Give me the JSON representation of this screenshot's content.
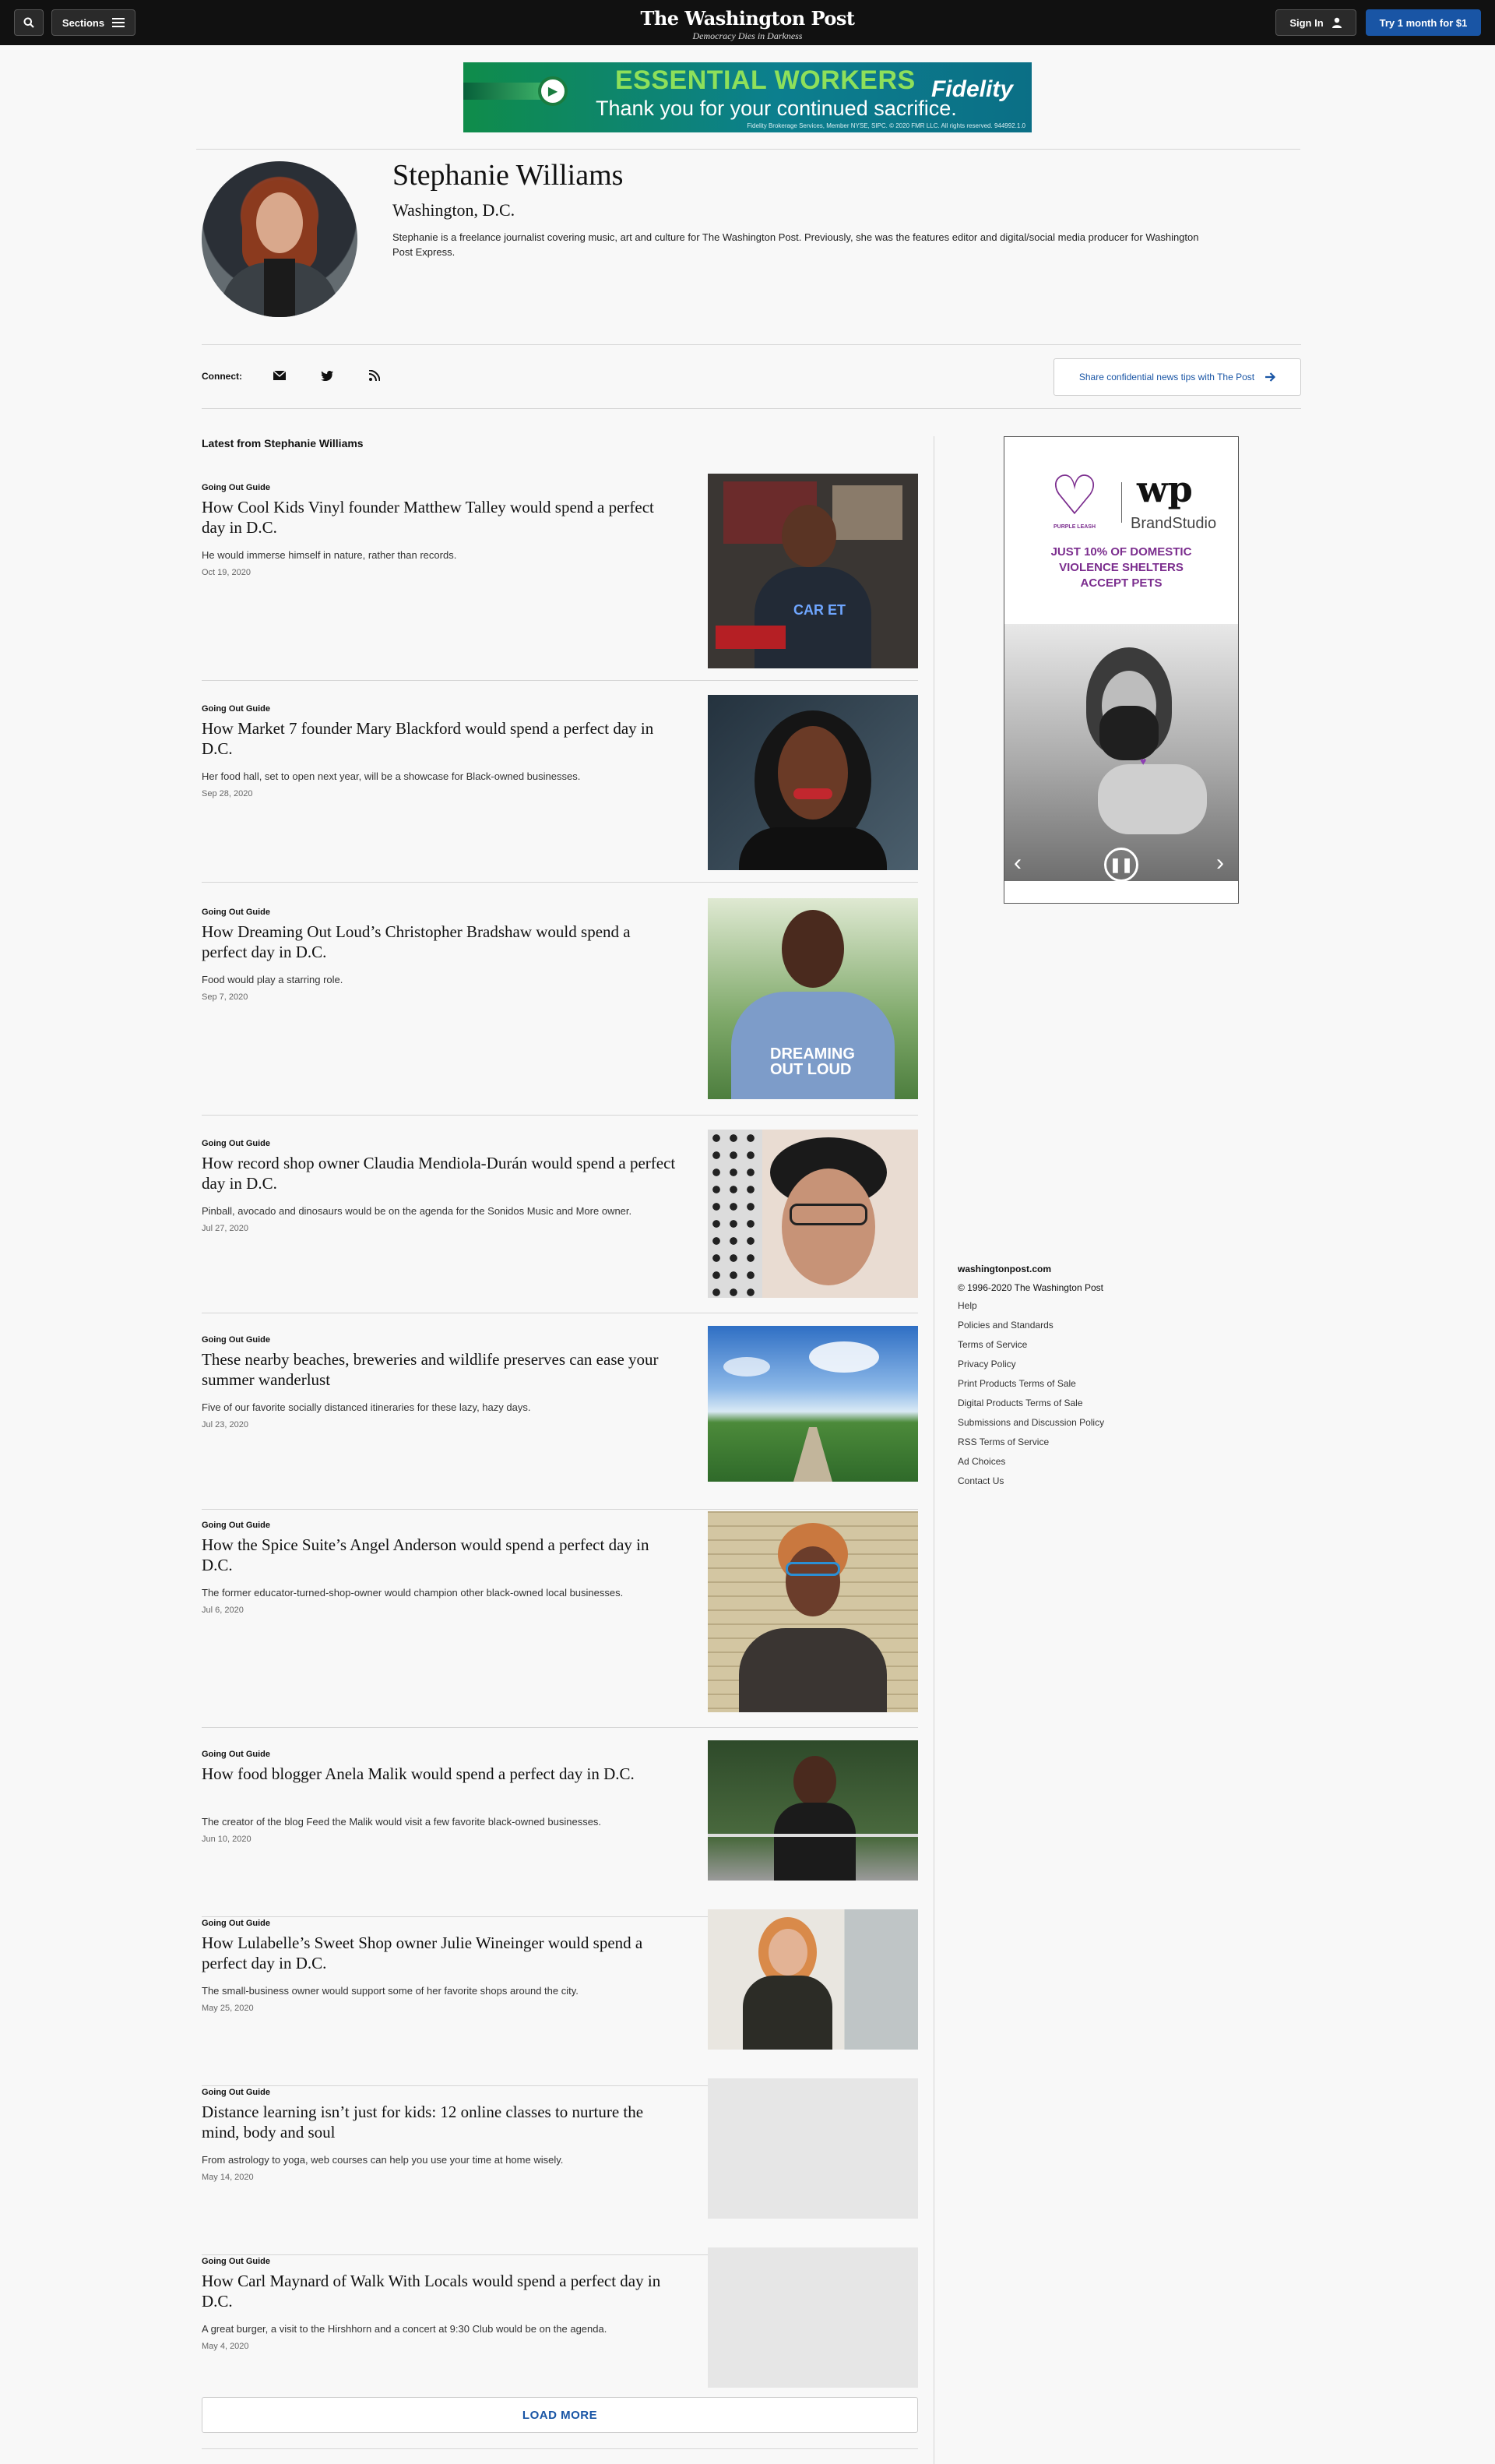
{
  "nav": {
    "sections_label": "Sections",
    "logo": "The Washington Post",
    "tagline": "Democracy Dies in Darkness",
    "signin_label": "Sign In",
    "try_label": "Try 1 month for $1"
  },
  "banner_ad": {
    "headline": "ESSENTIAL WORKERS",
    "subline": "Thank you for your continued sacrifice.",
    "brand": "Fidelity",
    "fine_print": "Fidelity Brokerage Services, Member NYSE, SIPC. © 2020 FMR LLC. All rights reserved. 944992.1.0"
  },
  "profile": {
    "name": "Stephanie Williams",
    "location": "Washington, D.C.",
    "bio": "Stephanie is a freelance journalist covering music, art and culture for The Washington Post. Previously, she was the features editor and digital/social media producer for Washington Post Express."
  },
  "connect": {
    "label": "Connect:",
    "tips_label": "Share confidential news tips with The Post"
  },
  "latest_heading": "Latest from Stephanie Williams",
  "articles": [
    {
      "kicker": "Going Out Guide",
      "title": "How Cool Kids Vinyl founder Matthew Talley would spend a perfect day in D.C.",
      "blurb": "He would immerse himself in nature, rather than records.",
      "date": "Oct 19, 2020"
    },
    {
      "kicker": "Going Out Guide",
      "title": "How Market 7 founder Mary Blackford would spend a perfect day in D.C.",
      "blurb": "Her food hall, set to open next year, will be a showcase for Black-owned businesses.",
      "date": "Sep 28, 2020"
    },
    {
      "kicker": "Going Out Guide",
      "title": "How Dreaming Out Loud’s Christopher Bradshaw would spend a perfect day in D.C.",
      "blurb": "Food would play a starring role.",
      "date": "Sep 7, 2020"
    },
    {
      "kicker": "Going Out Guide",
      "title": "How record shop owner Claudia Mendiola-Durán would spend a perfect day in D.C.",
      "blurb": "Pinball, avocado and dinosaurs would be on the agenda for the Sonidos Music and More owner.",
      "date": "Jul 27, 2020"
    },
    {
      "kicker": "Going Out Guide",
      "title": "These nearby beaches, breweries and wildlife preserves can ease your summer wanderlust",
      "blurb": "Five of our favorite socially distanced itineraries for these lazy, hazy days.",
      "date": "Jul 23, 2020"
    },
    {
      "kicker": "Going Out Guide",
      "title": "How the Spice Suite’s Angel Anderson would spend a perfect day in D.C.",
      "blurb": "The former educator-turned-shop-owner would champion other black-owned local businesses.",
      "date": "Jul 6, 2020"
    },
    {
      "kicker": "Going Out Guide",
      "title": "How food blogger Anela Malik would spend a perfect day in D.C.",
      "blurb": "The creator of the blog Feed the Malik would visit a few favorite black-owned businesses.",
      "date": "Jun 10, 2020"
    },
    {
      "kicker": "Going Out Guide",
      "title": "How Lulabelle’s Sweet Shop owner Julie Wineinger would spend a perfect day in D.C.",
      "blurb": "The small-business owner would support some of her favorite shops around the city.",
      "date": "May 25, 2020"
    },
    {
      "kicker": "Going Out Guide",
      "title": "Distance learning isn’t just for kids: 12 online classes to nurture the mind, body and soul",
      "blurb": "From astrology to yoga, web courses can help you use your time at home wisely.",
      "date": "May 14, 2020"
    },
    {
      "kicker": "Going Out Guide",
      "title": "How Carl Maynard of Walk With Locals would spend a perfect day in D.C.",
      "blurb": "A great burger, a visit to the Hirshhorn and a concert at 9:30 Club would be on the agenda.",
      "date": "May 4, 2020"
    }
  ],
  "load_more_label": "LOAD MORE",
  "side_ad": {
    "brand_left": "PURPLE LEASH",
    "brand_right_logo": "wp",
    "brand_right": "BrandStudio",
    "message": "JUST 10% OF DOMESTIC VIOLENCE SHELTERS ACCEPT PETS"
  },
  "footer": {
    "site": "washingtonpost.com",
    "copyright": "© 1996-2020 The Washington Post",
    "links": [
      "Help",
      "Policies and Standards",
      "Terms of Service",
      "Privacy Policy",
      "Print Products Terms of Sale",
      "Digital Products Terms of Sale",
      "Submissions and Discussion Policy",
      "RSS Terms of Service",
      "Ad Choices",
      "Contact Us"
    ]
  },
  "colors": {
    "accent": "#1955a5",
    "topbar": "#111111",
    "ad_purple": "#7b2d8e"
  }
}
